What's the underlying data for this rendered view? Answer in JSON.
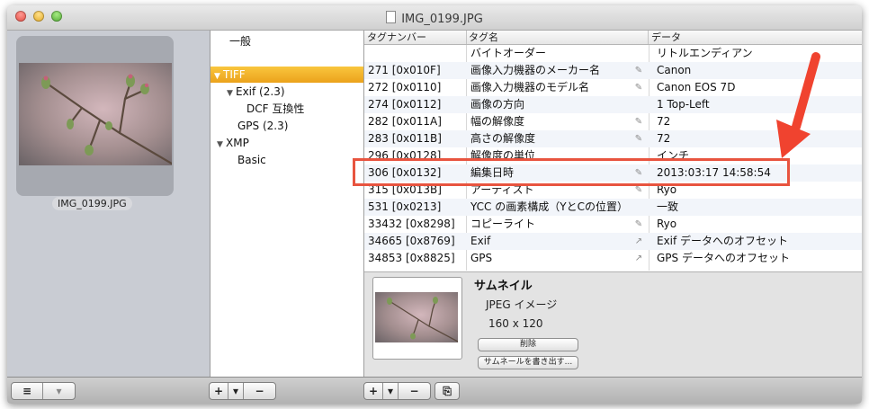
{
  "window": {
    "title": "IMG_0199.JPG"
  },
  "sidebar": {
    "thumbnail_name": "IMG_0199.JPG"
  },
  "tree": {
    "items": [
      {
        "label": "一般",
        "expanded": null,
        "indent": 0,
        "selected": false
      },
      {
        "label": "TIFF",
        "expanded": true,
        "indent": 0,
        "selected": true
      },
      {
        "label": "Exif (2.3)",
        "expanded": true,
        "indent": 1,
        "selected": false
      },
      {
        "label": "DCF 互換性",
        "expanded": null,
        "indent": 2,
        "selected": false
      },
      {
        "label": "GPS (2.3)",
        "expanded": null,
        "indent": 1,
        "selected": false
      },
      {
        "label": "XMP",
        "expanded": true,
        "indent": 0,
        "selected": false
      },
      {
        "label": "Basic",
        "expanded": null,
        "indent": 1,
        "selected": false
      }
    ]
  },
  "table": {
    "headers": {
      "tag_number": "タグナンバー",
      "tag_name": "タグ名",
      "data": "データ"
    },
    "rows": [
      {
        "tag": "",
        "name": "バイトオーダー",
        "icon": "",
        "value": "リトルエンディアン"
      },
      {
        "tag": "271 [0x010F]",
        "name": "画像入力機器のメーカー名",
        "icon": "pencil-icon",
        "value": "Canon"
      },
      {
        "tag": "272 [0x0110]",
        "name": "画像入力機器のモデル名",
        "icon": "pencil-icon",
        "value": "Canon EOS 7D"
      },
      {
        "tag": "274 [0x0112]",
        "name": "画像の方向",
        "icon": "",
        "value": "1 Top-Left"
      },
      {
        "tag": "282 [0x011A]",
        "name": "幅の解像度",
        "icon": "pencil-icon",
        "value": "72"
      },
      {
        "tag": "283 [0x011B]",
        "name": "高さの解像度",
        "icon": "pencil-icon",
        "value": "72"
      },
      {
        "tag": "296 [0x0128]",
        "name": "解像度の単位",
        "icon": "",
        "value": "インチ"
      },
      {
        "tag": "306 [0x0132]",
        "name": "編集日時",
        "icon": "pencil-icon",
        "value": "2013:03:17 14:58:54"
      },
      {
        "tag": "315 [0x013B]",
        "name": "アーティスト",
        "icon": "pencil-icon",
        "value": "Ryo"
      },
      {
        "tag": "531 [0x0213]",
        "name": "YCC の画素構成（YとCの位置）",
        "icon": "",
        "value": "一致"
      },
      {
        "tag": "33432 [0x8298]",
        "name": "コピーライト",
        "icon": "pencil-icon",
        "value": "Ryo"
      },
      {
        "tag": "34665 [0x8769]",
        "name": "Exif",
        "icon": "arrow-icon",
        "value": "Exif データへのオフセット"
      },
      {
        "tag": "34853 [0x8825]",
        "name": "GPS",
        "icon": "arrow-icon",
        "value": "GPS データへのオフセット"
      }
    ],
    "highlighted_row": 7
  },
  "thumbnail": {
    "title": "サムネイル",
    "type": "JPEG イメージ",
    "size": "160 x 120",
    "delete_label": "削除",
    "export_label": "サムネールを書き出す..."
  },
  "toolbar": {
    "list_icon": "list-icon",
    "add": "+",
    "remove": "−",
    "dropdown": "▾"
  },
  "colors": {
    "selection": "#f0a623",
    "highlight_box": "#e8543f",
    "arrow": "#f0432f"
  }
}
